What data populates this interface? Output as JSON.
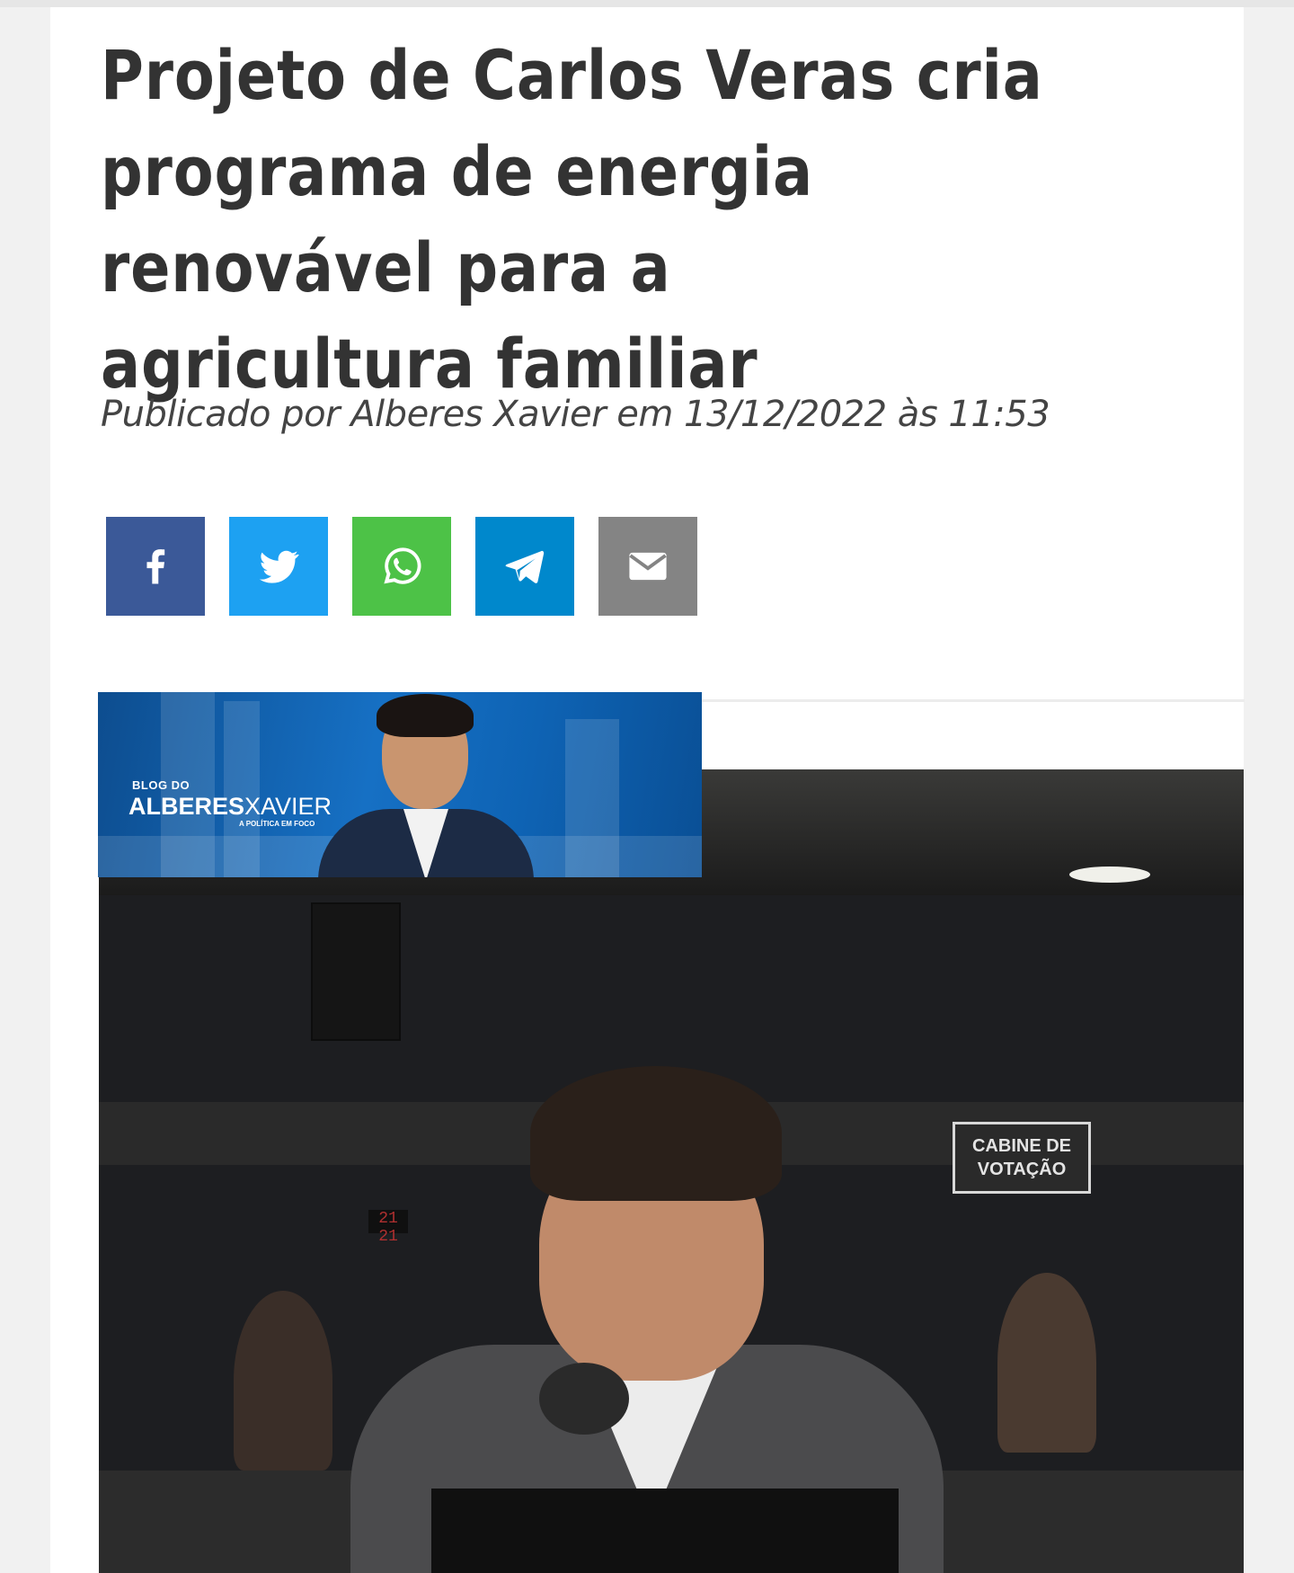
{
  "article": {
    "title": "Projeto de Carlos Veras cria programa de energia renovável para a agricultura familiar",
    "byline": "Publicado por Alberes Xavier em 13/12/2022 às 11:53"
  },
  "share_buttons": [
    {
      "name": "facebook",
      "icon": "facebook-icon",
      "color": "#3b5998"
    },
    {
      "name": "twitter",
      "icon": "twitter-icon",
      "color": "#1da1f2"
    },
    {
      "name": "whatsapp",
      "icon": "whatsapp-icon",
      "color": "#4dc247"
    },
    {
      "name": "telegram",
      "icon": "telegram-icon",
      "color": "#0088cc"
    },
    {
      "name": "email",
      "icon": "email-icon",
      "color": "#848484"
    }
  ],
  "banner": {
    "blog_label": "BLOG DO",
    "name_bold": "ALBERES",
    "name_light": "XAVIER",
    "tagline": "A POLÍTICA EM FOCO"
  },
  "photo": {
    "sign_line1": "CABINE DE",
    "sign_line2": "VOTAÇÃO",
    "clock": "21 21"
  }
}
